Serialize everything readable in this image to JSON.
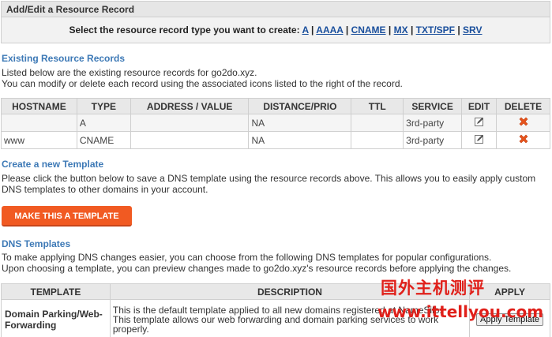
{
  "add_edit": {
    "title": "Add/Edit a Resource Record",
    "prompt": "Select the resource record type you want to create:",
    "types": [
      "A",
      "AAAA",
      "CNAME",
      "MX",
      "TXT/SPF",
      "SRV"
    ],
    "sep": "|"
  },
  "existing": {
    "heading": "Existing Resource Records",
    "line1": "Listed below are the existing resource records for go2do.xyz.",
    "line2": "You can modify or delete each record using the associated icons listed to the right of the record.",
    "columns": [
      "HOSTNAME",
      "TYPE",
      "ADDRESS / VALUE",
      "DISTANCE/PRIO",
      "TTL",
      "SERVICE",
      "EDIT",
      "DELETE"
    ],
    "rows": [
      {
        "hostname": "",
        "type": "A",
        "address": "",
        "distance": "NA",
        "ttl": "",
        "service": "3rd-party"
      },
      {
        "hostname": "www",
        "type": "CNAME",
        "address": "",
        "distance": "NA",
        "ttl": "",
        "service": "3rd-party"
      }
    ]
  },
  "create_template": {
    "heading": "Create a new Template",
    "line1": "Please click the button below to save a DNS template using the resource records above. This allows you to easily apply custom",
    "line2": "DNS templates to other domains in your account.",
    "button": "MAKE THIS A TEMPLATE"
  },
  "dns_templates": {
    "heading": "DNS Templates",
    "line1": "To make applying DNS changes easier, you can choose from the following DNS templates for popular configurations.",
    "line2": "Upon choosing a template, you can preview changes made to go2do.xyz's resource records before applying the changes.",
    "columns": [
      "TEMPLATE",
      "DESCRIPTION",
      "APPLY"
    ],
    "rows": [
      {
        "template": "Domain Parking/Web-Forwarding",
        "desc1": "This is the default template applied to all new domains registered at NameSilo.",
        "desc2": "This template allows our web forwarding and domain parking services to work",
        "desc3": "properly.",
        "apply": "Apply Template"
      }
    ]
  },
  "watermark": {
    "line1": "国外主机测评",
    "line2": "www.ittellyou.com"
  },
  "colors": {
    "accent_blue": "#3d79b6",
    "link_blue": "#1a4f9c",
    "button_orange": "#f15a22",
    "delete_red": "#e8541c",
    "watermark_red": "#e0201a"
  },
  "icons": {
    "edit": "pencil-edit-icon",
    "delete": "red-x-delete-icon"
  }
}
